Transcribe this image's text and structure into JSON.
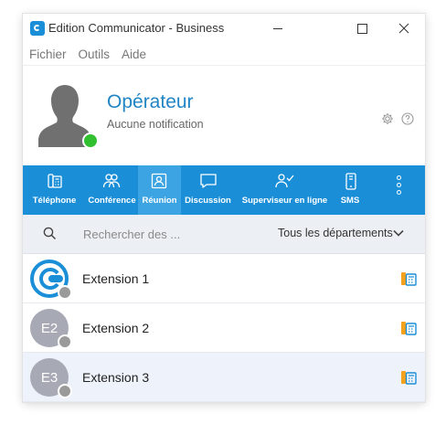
{
  "window": {
    "title": "Edition Communicator - Business"
  },
  "menu": [
    "Fichier",
    "Outils",
    "Aide"
  ],
  "profile": {
    "name": "Opérateur",
    "status": "Aucune notification",
    "presence_color": "#30c030"
  },
  "toolbar": {
    "accent": "#1a8fd8",
    "tabs": [
      {
        "label": "Téléphone",
        "icon": "desk-phone-icon"
      },
      {
        "label": "Conférence",
        "icon": "group-icon"
      },
      {
        "label": "Réunion",
        "icon": "meeting-icon",
        "active": true
      },
      {
        "label": "Discussion",
        "icon": "chat-icon"
      },
      {
        "label": "Superviseur en ligne",
        "icon": "supervisor-icon"
      },
      {
        "label": "SMS",
        "icon": "mobile-phone-icon"
      }
    ]
  },
  "search": {
    "placeholder": "Rechercher des ...",
    "department": "Tous les départements"
  },
  "extensions": [
    {
      "name": "Extension 1",
      "initials": "",
      "avatar": "app-logo"
    },
    {
      "name": "Extension 2",
      "initials": "E2"
    },
    {
      "name": "Extension 3",
      "initials": "E3",
      "selected": true
    }
  ]
}
